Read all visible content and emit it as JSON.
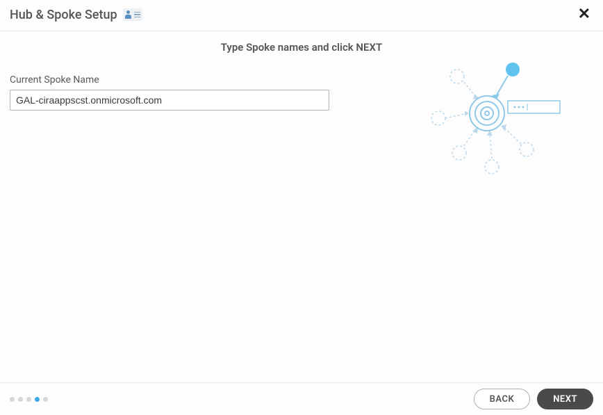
{
  "header": {
    "title": "Hub & Spoke Setup",
    "close_label": "✕"
  },
  "instruction": "Type Spoke names and click NEXT",
  "form": {
    "spoke_label": "Current Spoke Name",
    "spoke_value": "GAL-ciraappscst.onmicrosoft.com"
  },
  "stepper": {
    "total": 5,
    "active_index": 3
  },
  "footer": {
    "back_label": "BACK",
    "next_label": "NEXT"
  },
  "colors": {
    "accent": "#3aa7e0",
    "illustration_stroke": "#8fc9e8",
    "illustration_dashed": "#bcd9eb"
  }
}
